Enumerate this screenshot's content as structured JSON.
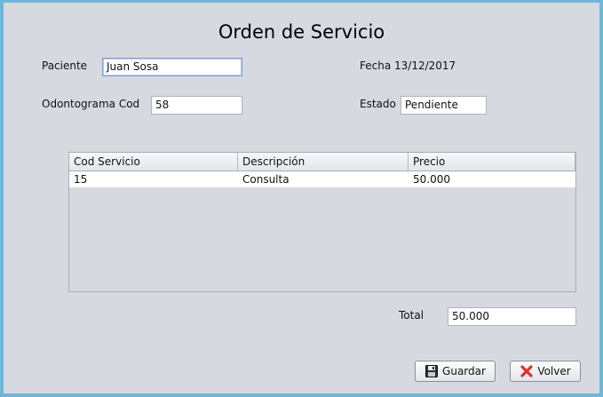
{
  "title": "Orden de Servicio",
  "form": {
    "paciente_label": "Paciente",
    "paciente_value": "Juan Sosa",
    "fecha_label": "Fecha",
    "fecha_value": "13/12/2017",
    "odontograma_label": "Odontograma Cod",
    "odontograma_value": "58",
    "estado_label": "Estado",
    "estado_value": "Pendiente"
  },
  "table": {
    "headers": [
      "Cod Servicio",
      "Descripción",
      "Precio"
    ],
    "rows": [
      [
        "15",
        "Consulta",
        "50.000"
      ]
    ]
  },
  "total": {
    "label": "Total",
    "value": "50.000"
  },
  "buttons": {
    "save_label": "Guardar",
    "save_icon": "floppy-disk-icon",
    "back_label": "Volver",
    "back_icon": "red-x-icon"
  },
  "colors": {
    "window_border": "#6fb7d8",
    "window_background": "#d6d9df",
    "close_x": "#e0302a"
  }
}
